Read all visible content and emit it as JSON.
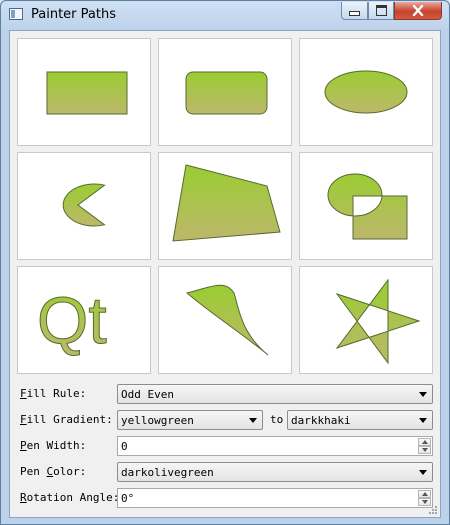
{
  "window": {
    "title": "Painter Paths"
  },
  "colors": {
    "fill_top": "#9acd32",
    "fill_bottom": "#bdb76b",
    "pen": "#556b2f"
  },
  "paths": [
    {
      "name": "Rectangle"
    },
    {
      "name": "Rounded Rectangle"
    },
    {
      "name": "Ellipse"
    },
    {
      "name": "Pie"
    },
    {
      "name": "Polygon"
    },
    {
      "name": "Group"
    },
    {
      "name": "Text",
      "text": "Qt"
    },
    {
      "name": "Curve"
    },
    {
      "name": "Star"
    }
  ],
  "controls": {
    "fill_rule": {
      "label_pre": "",
      "label_u": "F",
      "label_post": "ill Rule:",
      "value": "Odd Even"
    },
    "fill_gradient": {
      "label_pre": "",
      "label_u": "F",
      "label_post": "ill Gradient:",
      "value1": "yellowgreen",
      "to": "to",
      "value2": "darkkhaki"
    },
    "pen_width": {
      "label_pre": "",
      "label_u": "P",
      "label_post": "en Width:",
      "value": "0"
    },
    "pen_color": {
      "label_pre": "Pen ",
      "label_u": "C",
      "label_post": "olor:",
      "value": "darkolivegreen"
    },
    "rotation": {
      "label_pre": "",
      "label_u": "R",
      "label_post": "otation Angle:",
      "value": "0°"
    }
  }
}
